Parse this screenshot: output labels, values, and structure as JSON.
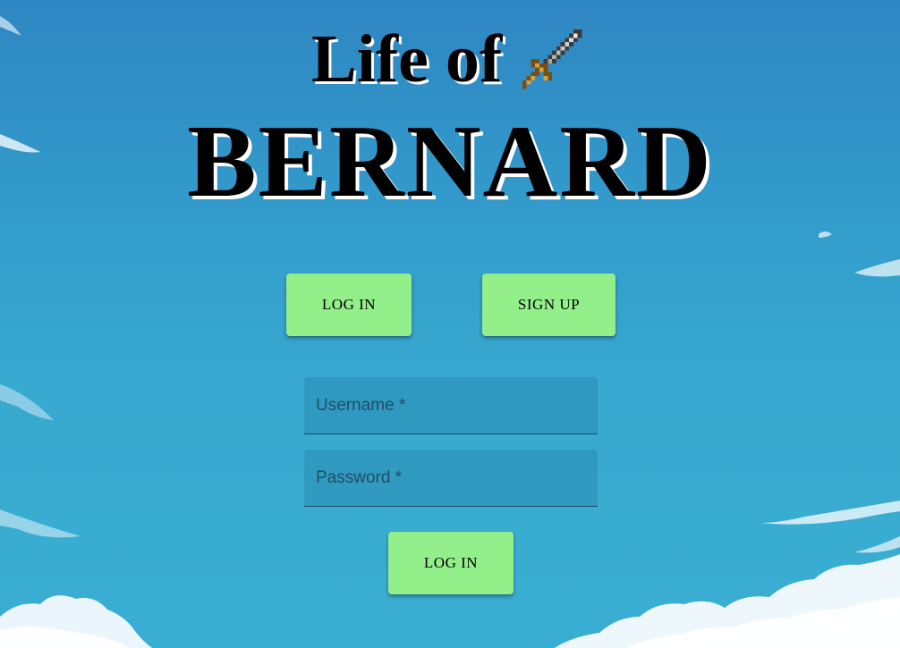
{
  "app": {
    "title_line1": "Life of",
    "title_line2": "BERNARD",
    "logo_icon": "sword-icon"
  },
  "tabs": {
    "login_label": "LOG IN",
    "signup_label": "SIGN UP"
  },
  "form": {
    "username_placeholder": "Username *",
    "password_placeholder": "Password *",
    "submit_label": "LOG IN"
  },
  "colors": {
    "button_bg": "#93ef8a",
    "sky_top": "#2f86c2",
    "sky_bottom": "#3aaed2",
    "title_text": "#000000",
    "title_shadow": "#ffffff"
  }
}
